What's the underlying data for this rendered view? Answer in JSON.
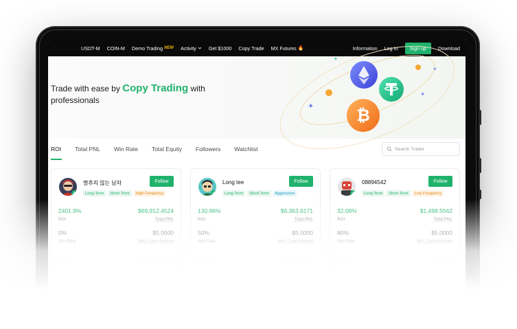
{
  "nav": {
    "left_items": [
      {
        "label": "USDT-M"
      },
      {
        "label": "COIN-M"
      },
      {
        "label": "Demo Trading",
        "badge": "NEW"
      },
      {
        "label": "Activity",
        "has_dropdown": true
      },
      {
        "label": "Get $1000"
      },
      {
        "label": "Copy Trade"
      },
      {
        "label": "MX Futures"
      }
    ],
    "right_items": {
      "information": "Information",
      "login": "Log In",
      "signup": "Sign up",
      "download": "Download"
    }
  },
  "hero": {
    "title_prefix": "Trade with ease by",
    "title_accent": "Copy Trading",
    "title_suffix": "with",
    "title_line2": "professionals"
  },
  "tabs": [
    "ROI",
    "Total PNL",
    "Win Rate",
    "Total Equity",
    "Followers",
    "Watchlist"
  ],
  "active_tab": "ROI",
  "search": {
    "placeholder": "Search Trader"
  },
  "traders": [
    {
      "name": "명추지 않는 남자",
      "follow_label": "Follow",
      "tags": [
        {
          "label": "Long Term",
          "color": "green"
        },
        {
          "label": "Short Term",
          "color": "green"
        },
        {
          "label": "High Frequency",
          "color": "orange"
        }
      ],
      "roi": "2401.9%",
      "roi_label": "ROI",
      "total_pnl": "$69,912.4524",
      "total_pnl_label": "Total PNL",
      "win_rate": "0%",
      "win_rate_label": "Win Rate",
      "min_copy": "$5.0000",
      "min_copy_label": "Min. Copy Amount",
      "footer_left": "231/300",
      "footer_right": "21,309.7253 USDT"
    },
    {
      "name": "Long tee",
      "follow_label": "Follow",
      "tags": [
        {
          "label": "Long Term",
          "color": "green"
        },
        {
          "label": "Short Term",
          "color": "green"
        },
        {
          "label": "Aggressive",
          "color": "teal"
        }
      ],
      "roi": "130.96%",
      "roi_label": "ROI",
      "total_pnl": "$6,363.6171",
      "total_pnl_label": "Total PNL",
      "win_rate": "50%",
      "win_rate_label": "Win Rate",
      "min_copy": "$5.0000",
      "min_copy_label": "Min. Copy Amount",
      "footer_left": "38/300",
      "footer_right": "8,230.4477 USDT"
    },
    {
      "name": "08894542",
      "follow_label": "Follow",
      "tags": [
        {
          "label": "Long Term",
          "color": "green"
        },
        {
          "label": "Short Term",
          "color": "green"
        },
        {
          "label": "Low Frequency",
          "color": "orange"
        }
      ],
      "roi": "32.06%",
      "roi_label": "ROI",
      "total_pnl": "$1,498.5562",
      "total_pnl_label": "Total PNL",
      "win_rate": "80%",
      "win_rate_label": "Win Rate",
      "min_copy": "$5.0000",
      "min_copy_label": "Min. Copy Amount",
      "footer_left": "9/300",
      "footer_right": "*****USDT"
    }
  ],
  "colors": {
    "accent": "#20b26c",
    "nav_bg": "#0a0a0a",
    "orange_tag": "#e5850f",
    "teal_tag": "#1e9fbf"
  },
  "icons": [
    "search-icon",
    "chevron-down-icon",
    "fire-icon",
    "plus-badge-icon",
    "ethereum-coin-icon",
    "tether-coin-icon",
    "bitcoin-coin-icon",
    "sparkle-icon"
  ]
}
